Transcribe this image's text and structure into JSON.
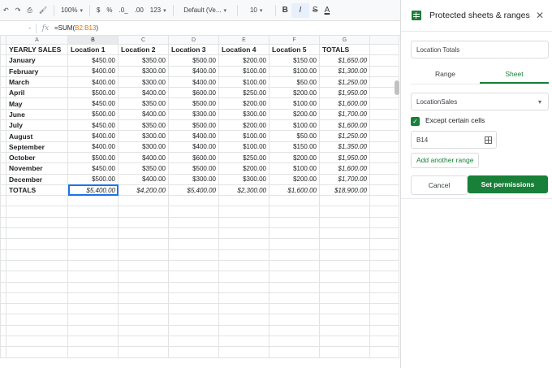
{
  "toolbar": {
    "zoom": "100%",
    "currency": "$",
    "percent": "%",
    "decrease_decimals": ".0_",
    "increase_decimals": ".00",
    "more_formats": "123",
    "font": "Default (Ve...",
    "font_size": "10",
    "bold": "B",
    "italic": "I",
    "strikethrough": "S",
    "text_color": "A"
  },
  "formula_bar": {
    "cell_ref": "-",
    "fx": "fx",
    "prefix": "=SUM(",
    "range": "B2:B13",
    "suffix": ")"
  },
  "grid": {
    "columns": [
      "A",
      "B",
      "C",
      "D",
      "E",
      "F",
      "G"
    ],
    "header_row": [
      "YEARLY SALES",
      "Location 1",
      "Location 2",
      "Location 3",
      "Location 4",
      "Location 5",
      "TOTALS"
    ],
    "rows": [
      [
        "January",
        "$450.00",
        "$350.00",
        "$500.00",
        "$200.00",
        "$150.00",
        "$1,650.00"
      ],
      [
        "February",
        "$400.00",
        "$300.00",
        "$400.00",
        "$100.00",
        "$100.00",
        "$1,300.00"
      ],
      [
        "March",
        "$400.00",
        "$300.00",
        "$400.00",
        "$100.00",
        "$50.00",
        "$1,250.00"
      ],
      [
        "April",
        "$500.00",
        "$400.00",
        "$600.00",
        "$250.00",
        "$200.00",
        "$1,950.00"
      ],
      [
        "May",
        "$450.00",
        "$350.00",
        "$500.00",
        "$200.00",
        "$100.00",
        "$1,600.00"
      ],
      [
        "June",
        "$500.00",
        "$400.00",
        "$300.00",
        "$300.00",
        "$200.00",
        "$1,700.00"
      ],
      [
        "July",
        "$450.00",
        "$350.00",
        "$500.00",
        "$200.00",
        "$100.00",
        "$1,600.00"
      ],
      [
        "August",
        "$400.00",
        "$300.00",
        "$400.00",
        "$100.00",
        "$50.00",
        "$1,250.00"
      ],
      [
        "September",
        "$400.00",
        "$300.00",
        "$400.00",
        "$100.00",
        "$150.00",
        "$1,350.00"
      ],
      [
        "October",
        "$500.00",
        "$400.00",
        "$600.00",
        "$250.00",
        "$200.00",
        "$1,950.00"
      ],
      [
        "November",
        "$450.00",
        "$350.00",
        "$500.00",
        "$200.00",
        "$100.00",
        "$1,600.00"
      ],
      [
        "December",
        "$500.00",
        "$400.00",
        "$300.00",
        "$300.00",
        "$200.00",
        "$1,700.00"
      ]
    ],
    "totals_row": [
      "TOTALS",
      "$5,400.00",
      "$4,200.00",
      "$5,400.00",
      "$2,300.00",
      "$1,600.00",
      "$18,900.00"
    ]
  },
  "panel": {
    "title": "Protected sheets & ranges",
    "description_value": "Location Totals",
    "tabs": [
      "Range",
      "Sheet"
    ],
    "active_tab": "Sheet",
    "sheet_select": "LocationSales",
    "except_label": "Except certain cells",
    "except_checked": true,
    "range_value": "B14",
    "add_range": "Add another range",
    "cancel": "Cancel",
    "set_permissions": "Set permissions"
  },
  "colors": {
    "accent_green": "#188038",
    "selection_blue": "#1a73e8",
    "formula_range": "#e37400"
  },
  "icons": [
    "undo-icon",
    "redo-icon",
    "print-icon",
    "paint-format-icon",
    "sheets-icon",
    "close-icon",
    "dropdown-caret-icon",
    "grid-select-icon",
    "check-icon"
  ]
}
